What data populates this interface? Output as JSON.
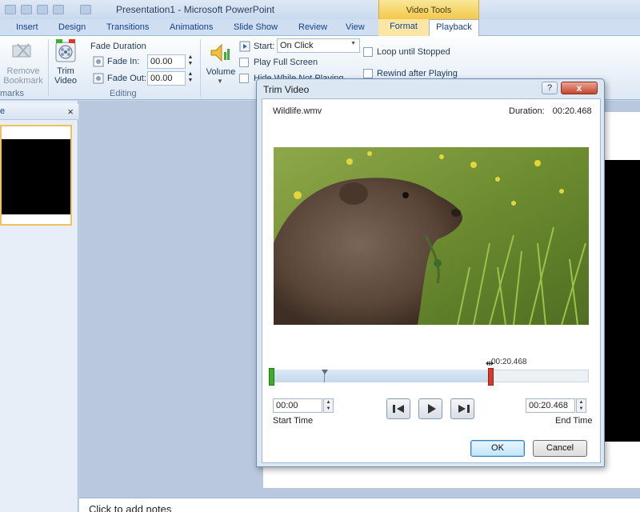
{
  "window": {
    "title": "Presentation1 - Microsoft PowerPoint",
    "contextual_tab_group": "Video Tools"
  },
  "tabs": [
    "Insert",
    "Design",
    "Transitions",
    "Animations",
    "Slide Show",
    "Review",
    "View",
    "Format",
    "Playback"
  ],
  "active_tab": "Playback",
  "ribbon": {
    "remove_bookmark": "Remove\nBookmark",
    "bookmarks_group": "marks",
    "trim_video": "Trim\nVideo",
    "fade_duration": "Fade Duration",
    "fade_in_label": "Fade In:",
    "fade_in_value": "00.00",
    "fade_out_label": "Fade Out:",
    "fade_out_value": "00.00",
    "editing_group": "Editing",
    "volume": "Volume",
    "start_label": "Start:",
    "start_value": "On Click",
    "play_full_screen": "Play Full Screen",
    "hide_while_not_playing": "Hide While Not Playing",
    "loop_until_stopped": "Loop until Stopped",
    "rewind_after_playing": "Rewind after Playing"
  },
  "left_pane": {
    "tab_label": "e",
    "close": "×"
  },
  "notes": {
    "placeholder": "Click to add notes"
  },
  "dialog": {
    "title": "Trim Video",
    "help": "?",
    "close": "x",
    "file_name": "Wildlife.wmv",
    "duration_label": "Duration:",
    "duration_value": "00:20.468",
    "timeline_time": "00:20.468",
    "start_time_value": "00:00",
    "start_time_label": "Start Time",
    "end_time_value": "00:20.468",
    "end_time_label": "End Time",
    "ok": "OK",
    "cancel": "Cancel",
    "selection_end_fraction": 0.69
  },
  "colors": {
    "start_marker": "#3dad2b",
    "end_marker": "#d8392b",
    "video_tools": "#f3c84a"
  }
}
